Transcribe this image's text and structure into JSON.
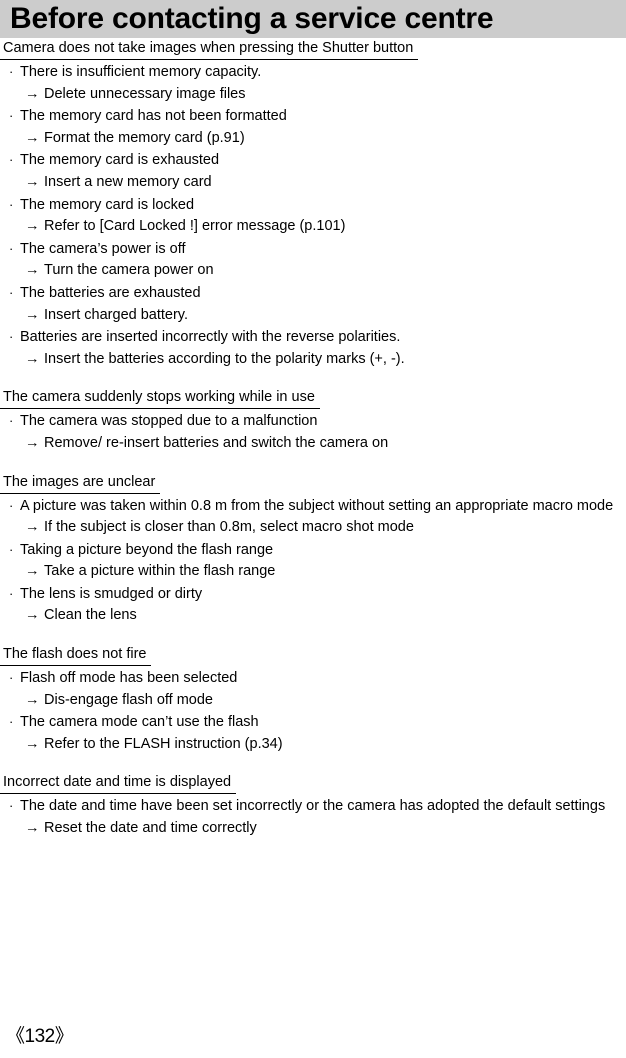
{
  "header": {
    "title": "Before contacting a service centre",
    "background_color": "#cccccc"
  },
  "footer": {
    "page_label": "《132》"
  },
  "markers": {
    "bullet": "·",
    "arrow": "→"
  },
  "sections": [
    {
      "heading": "Camera does not take images when pressing the Shutter button",
      "items": [
        {
          "type": "bullet",
          "text": "There is insufficient memory capacity."
        },
        {
          "type": "arrow",
          "text": "Delete unnecessary image files"
        },
        {
          "type": "bullet",
          "text": "The memory card has not been formatted"
        },
        {
          "type": "arrow",
          "text": "Format the memory card (p.91)"
        },
        {
          "type": "bullet",
          "text": "The memory card is exhausted"
        },
        {
          "type": "arrow",
          "text": "Insert a new memory card"
        },
        {
          "type": "bullet",
          "text": "The memory card is locked"
        },
        {
          "type": "arrow",
          "text": "Refer to [Card Locked !] error message (p.101)"
        },
        {
          "type": "bullet",
          "text": "The camera’s power is off"
        },
        {
          "type": "arrow",
          "text": "Turn the camera power on"
        },
        {
          "type": "bullet",
          "text": "The batteries are exhausted"
        },
        {
          "type": "arrow",
          "text": "Insert charged battery."
        },
        {
          "type": "bullet",
          "text": "Batteries are inserted incorrectly with the reverse polarities."
        },
        {
          "type": "arrow",
          "text": "Insert the batteries according to the polarity marks (+, -)."
        }
      ]
    },
    {
      "heading": "The camera suddenly stops working while in use",
      "items": [
        {
          "type": "bullet",
          "text": "The camera was stopped due to a malfunction"
        },
        {
          "type": "arrow",
          "text": "Remove/ re-insert batteries and switch the camera on"
        }
      ]
    },
    {
      "heading": "The images are unclear",
      "items": [
        {
          "type": "bullet",
          "text": "A picture was taken within 0.8 m from the subject without setting an appropriate macro mode"
        },
        {
          "type": "arrow",
          "text": "If the subject is closer than 0.8m, select macro shot mode"
        },
        {
          "type": "bullet",
          "text": "Taking a picture beyond the flash range"
        },
        {
          "type": "arrow",
          "text": "Take a picture within the flash range"
        },
        {
          "type": "bullet",
          "text": "The lens is smudged or dirty"
        },
        {
          "type": "arrow",
          "text": "Clean the lens"
        }
      ]
    },
    {
      "heading": "The flash does not fire",
      "items": [
        {
          "type": "bullet",
          "text": "Flash off mode has been selected"
        },
        {
          "type": "arrow",
          "text": "Dis-engage flash off mode"
        },
        {
          "type": "bullet",
          "text": "The camera mode can’t use the flash"
        },
        {
          "type": "arrow",
          "text": "Refer to the FLASH instruction (p.34)"
        }
      ]
    },
    {
      "heading": "Incorrect date and time is displayed",
      "items": [
        {
          "type": "bullet",
          "text": "The date and time have been set incorrectly or the camera has adopted the default settings"
        },
        {
          "type": "arrow",
          "text": "Reset the date and time correctly"
        }
      ]
    }
  ]
}
